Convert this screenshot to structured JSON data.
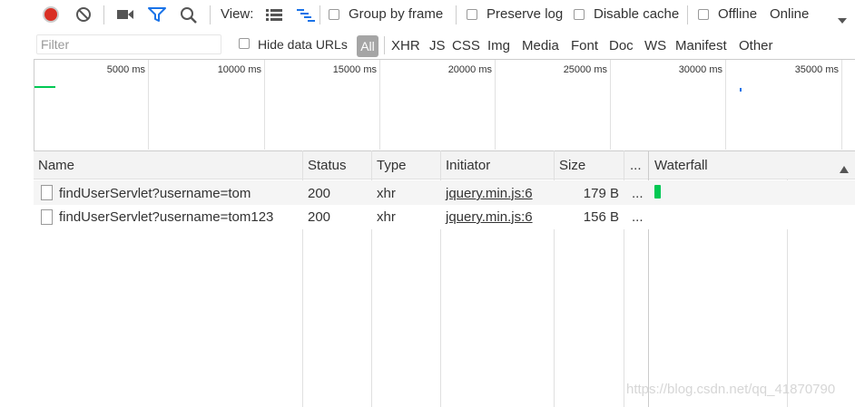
{
  "toolbar": {
    "view_label": "View:",
    "group_by_frame": "Group by frame",
    "preserve_log": "Preserve log",
    "disable_cache": "Disable cache",
    "offline": "Offline",
    "throttle": "Online"
  },
  "filter_bar": {
    "placeholder": "Filter",
    "hide_data_urls": "Hide data URLs",
    "types": [
      "All",
      "XHR",
      "JS",
      "CSS",
      "Img",
      "Media",
      "Font",
      "Doc",
      "WS",
      "Manifest",
      "Other"
    ]
  },
  "overview": {
    "ticks": [
      "5000 ms",
      "10000 ms",
      "15000 ms",
      "20000 ms",
      "25000 ms",
      "30000 ms",
      "35000 ms"
    ]
  },
  "table": {
    "columns": [
      "Name",
      "Status",
      "Type",
      "Initiator",
      "Size",
      "...",
      "Waterfall"
    ],
    "rows": [
      {
        "name": "findUserServlet?username=tom",
        "status": "200",
        "type": "xhr",
        "initiator": "jquery.min.js:6",
        "size": "179 B",
        "more": "..."
      },
      {
        "name": "findUserServlet?username=tom123",
        "status": "200",
        "type": "xhr",
        "initiator": "jquery.min.js:6",
        "size": "156 B",
        "more": "..."
      }
    ]
  },
  "watermark": "https://blog.csdn.net/qq_41870790",
  "colors": {
    "record": "#d93025",
    "accent": "#1a73e8",
    "waterfall_bar": "#00c853"
  }
}
